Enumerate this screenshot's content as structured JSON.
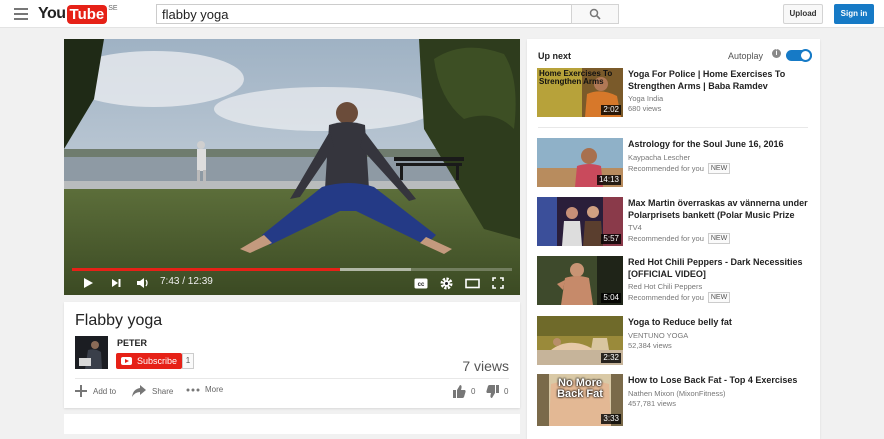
{
  "header": {
    "logo_you": "You",
    "logo_tube": "Tube",
    "country": "SE",
    "search_value": "flabby yoga",
    "upload_label": "Upload",
    "signin_label": "Sign in"
  },
  "player": {
    "time": "7:43 / 12:39",
    "progress_fraction": 0.61,
    "loaded_fraction": 0.77
  },
  "video": {
    "title": "Flabby yoga",
    "channel": "PETER",
    "subscribe_label": "Subscribe",
    "subscriber_count": "1",
    "views": "7 views",
    "add_to_label": "Add to",
    "share_label": "Share",
    "more_label": "More",
    "likes": "0",
    "dislikes": "0"
  },
  "sidebar": {
    "up_next_label": "Up next",
    "autoplay_label": "Autoplay",
    "autoplay_on": true,
    "items": [
      {
        "title": "Yoga For Police | Home Exercises To Strengthen Arms | Baba Ramdev",
        "channel": "Yoga India",
        "meta": "680 views",
        "badge": "",
        "duration": "2:02",
        "thumb_text": "Home Exercises To Strengthen Arms"
      },
      {
        "title": "Astrology for the Soul June 16, 2016",
        "channel": "Kaypacha Lescher",
        "meta": "Recommended for you",
        "badge": "NEW",
        "duration": "14:13",
        "thumb_text": ""
      },
      {
        "title": "Max Martin överraskas av vännerna under Polarprisets bankett (Polar Music Prize",
        "channel": "TV4",
        "meta": "Recommended for you",
        "badge": "NEW",
        "duration": "5:57",
        "thumb_text": ""
      },
      {
        "title": "Red Hot Chili Peppers - Dark Necessities [OFFICIAL VIDEO]",
        "channel": "Red Hot Chili Peppers",
        "meta": "Recommended for you",
        "badge": "NEW",
        "duration": "5:04",
        "thumb_text": ""
      },
      {
        "title": "Yoga to Reduce belly fat",
        "channel": "VENTUNO YOGA",
        "meta": "52,384 views",
        "badge": "",
        "duration": "2:32",
        "thumb_text": ""
      },
      {
        "title": "How to Lose Back Fat - Top 4 Exercises",
        "channel": "Nathen Mixon (MixonFitness)",
        "meta": "457,781 views",
        "badge": "",
        "duration": "3:33",
        "thumb_text": "No More Back Fat"
      }
    ]
  },
  "colors": {
    "brand_red": "#e62117",
    "accent_blue": "#167ac6"
  }
}
